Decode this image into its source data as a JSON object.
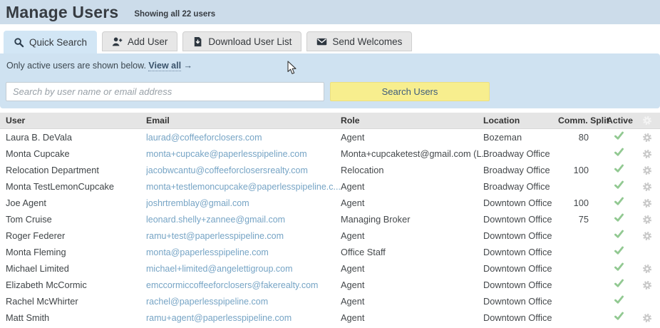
{
  "page": {
    "title": "Manage Users",
    "subtitle": "Showing all 22 users"
  },
  "tabs": [
    {
      "label": "Quick Search",
      "icon": "search-icon",
      "active": true
    },
    {
      "label": "Add User",
      "icon": "add-user-icon",
      "active": false
    },
    {
      "label": "Download User List",
      "icon": "download-icon",
      "active": false
    },
    {
      "label": "Send Welcomes",
      "icon": "envelope-icon",
      "active": false
    }
  ],
  "filter_bar": {
    "text": "Only active users are shown below.",
    "link_label": "View all",
    "arrow": "→"
  },
  "search": {
    "placeholder": "Search by user name or email address",
    "button_label": "Search Users"
  },
  "table": {
    "headers": {
      "user": "User",
      "email": "Email",
      "role": "Role",
      "location": "Location",
      "comm_split": "Comm. Split",
      "active": "Active"
    },
    "rows": [
      {
        "user": "Laura B. DeVala",
        "email": "laurad@coffeeforclosers.com",
        "role": "Agent",
        "location": "Bozeman",
        "comm_split": "80",
        "active": true,
        "settings_gear": true
      },
      {
        "user": "Monta Cupcake",
        "email": "monta+cupcake@paperlesspipeline.com",
        "role": "Monta+cupcaketest@gmail.com (L...",
        "location": "Broadway Office",
        "comm_split": "",
        "active": true,
        "settings_gear": true
      },
      {
        "user": "Relocation Department",
        "email": "jacobwcantu@coffeeforclosersrealty.com",
        "role": "Relocation",
        "location": "Broadway Office",
        "comm_split": "100",
        "active": true,
        "settings_gear": true
      },
      {
        "user": "Monta TestLemonCupcake",
        "email": "monta+testlemoncupcake@paperlesspipeline.c...",
        "role": "Agent",
        "location": "Broadway Office",
        "comm_split": "",
        "active": true,
        "settings_gear": true
      },
      {
        "user": "Joe Agent",
        "email": "joshrtremblay@gmail.com",
        "role": "Agent",
        "location": "Downtown Office",
        "comm_split": "100",
        "active": true,
        "settings_gear": true
      },
      {
        "user": "Tom Cruise",
        "email": "leonard.shelly+zannee@gmail.com",
        "role": "Managing Broker",
        "location": "Downtown Office",
        "comm_split": "75",
        "active": true,
        "settings_gear": true
      },
      {
        "user": "Roger Federer",
        "email": "ramu+test@paperlesspipeline.com",
        "role": "Agent",
        "location": "Downtown Office",
        "comm_split": "",
        "active": true,
        "settings_gear": true
      },
      {
        "user": "Monta Fleming",
        "email": "monta@paperlesspipeline.com",
        "role": "Office Staff",
        "location": "Downtown Office",
        "comm_split": "",
        "active": true,
        "settings_gear": false
      },
      {
        "user": "Michael Limited",
        "email": "michael+limited@angelettigroup.com",
        "role": "Agent",
        "location": "Downtown Office",
        "comm_split": "",
        "active": true,
        "settings_gear": true
      },
      {
        "user": "Elizabeth McCormic",
        "email": "emccormiccoffeeforclosers@fakerealty.com",
        "role": "Agent",
        "location": "Downtown Office",
        "comm_split": "",
        "active": true,
        "settings_gear": true
      },
      {
        "user": "Rachel McWhirter",
        "email": "rachel@paperlesspipeline.com",
        "role": "Agent",
        "location": "Downtown Office",
        "comm_split": "",
        "active": true,
        "settings_gear": false
      },
      {
        "user": "Matt Smith",
        "email": "ramu+agent@paperlesspipeline.com",
        "role": "Agent",
        "location": "Downtown Office",
        "comm_split": "",
        "active": true,
        "settings_gear": true
      }
    ]
  },
  "colors": {
    "top_band": "#ccdcea",
    "panel_blue": "#cfe2f1",
    "active_tab": "#d2e6f5",
    "button_yellow": "#f7ee8e",
    "button_text": "#3d5c7c",
    "link_blue": "#76a4c5",
    "check_green": "#92c992",
    "gear_gray": "#c9c9c9",
    "header_gray": "#e5e5e5",
    "title_text": "#373c42"
  }
}
